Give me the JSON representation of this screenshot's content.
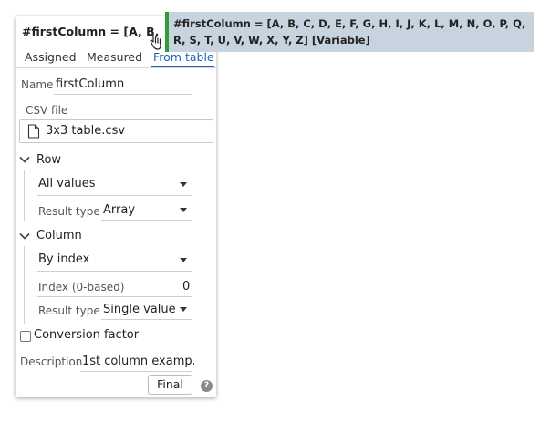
{
  "header": {
    "title": "#firstColumn = [A, B, C, ..."
  },
  "tabs": [
    {
      "label": "Assigned"
    },
    {
      "label": "Measured"
    },
    {
      "label": "From table",
      "active": true
    }
  ],
  "name_field": {
    "label": "Name",
    "value": "firstColumn"
  },
  "csv_file": {
    "label": "CSV file",
    "value": "3x3 table.csv"
  },
  "row_section": {
    "title": "Row",
    "select_value": "All values",
    "result_type_label": "Result type",
    "result_type_value": "Array"
  },
  "column_section": {
    "title": "Column",
    "select_value": "By index",
    "index_label": "Index (0-based)",
    "index_value": "0",
    "result_type_label": "Result type",
    "result_type_value": "Single value"
  },
  "conversion_factor": {
    "label": "Conversion factor",
    "checked": false
  },
  "description": {
    "label": "Description",
    "value": "1st column examp..."
  },
  "final_button": {
    "label": "Final"
  },
  "help_icon": {
    "glyph": "?"
  },
  "tooltip": {
    "text": "#firstColumn = [A, B, C, D, E, F, G, H, I, J, K, L, M, N, O, P, Q, R, S, T, U, V, W, X, Y, Z] [Variable]"
  },
  "colors": {
    "accent": "#1e64b4",
    "tooltip_bg": "#c8d3e0",
    "tooltip_bar": "#2e9e36"
  }
}
